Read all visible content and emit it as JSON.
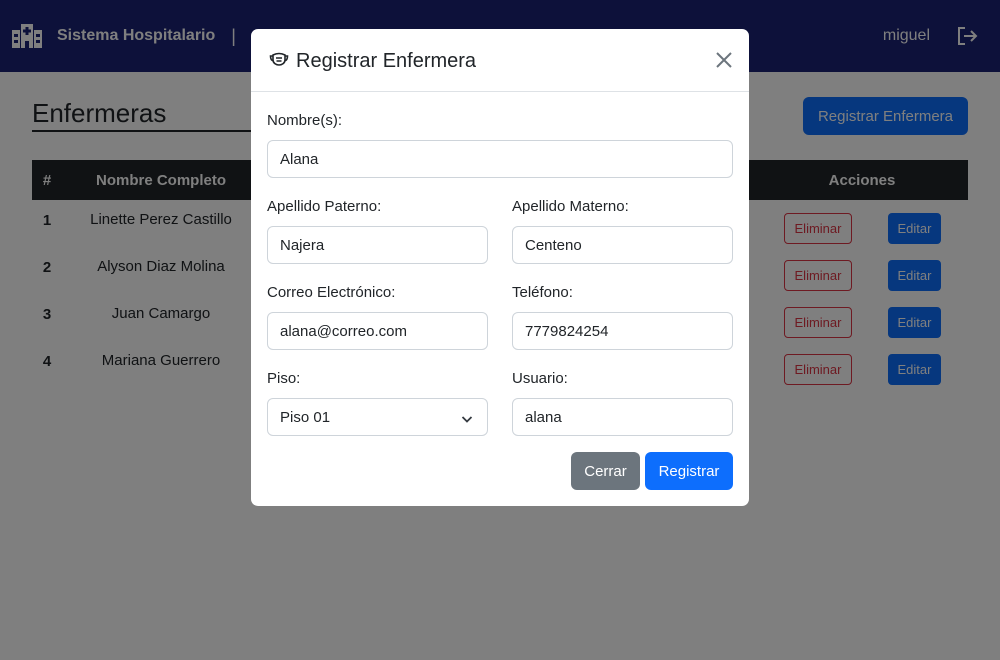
{
  "navbar": {
    "brand": "Sistema Hospitalario",
    "separator": "|",
    "user": "miguel"
  },
  "page": {
    "title": "Enfermeras",
    "register_button": "Registrar Enfermera"
  },
  "table": {
    "headers": {
      "num": "#",
      "name": "Nombre Completo",
      "actions": "Acciones"
    },
    "rows": [
      {
        "num": "1",
        "name": "Linette Perez Castillo"
      },
      {
        "num": "2",
        "name": "Alyson Diaz Molina"
      },
      {
        "num": "3",
        "name": "Juan Camargo"
      },
      {
        "num": "4",
        "name": "Mariana Guerrero"
      }
    ],
    "delete_label": "Eliminar",
    "edit_label": "Editar"
  },
  "modal": {
    "title": "Registrar Enfermera",
    "fields": {
      "nombre": {
        "label": "Nombre(s):",
        "value": "Alana"
      },
      "paterno": {
        "label": "Apellido Paterno:",
        "value": "Najera"
      },
      "materno": {
        "label": "Apellido Materno:",
        "value": "Centeno"
      },
      "correo": {
        "label": "Correo Electrónico:",
        "value": "alana@correo.com"
      },
      "telefono": {
        "label": "Teléfono:",
        "value": "7779824254"
      },
      "piso": {
        "label": "Piso:",
        "value": "Piso 01"
      },
      "usuario": {
        "label": "Usuario:",
        "value": "alana"
      }
    },
    "cerrar": "Cerrar",
    "registrar": "Registrar"
  },
  "colors": {
    "navbar": "#1a2275",
    "primary": "#0d6efd",
    "danger": "#dc3545",
    "secondary": "#6c757d",
    "table_header": "#212529"
  },
  "icons": [
    "hospital-icon",
    "logout-icon",
    "mask-icon",
    "close-icon",
    "chevron-down-icon"
  ]
}
